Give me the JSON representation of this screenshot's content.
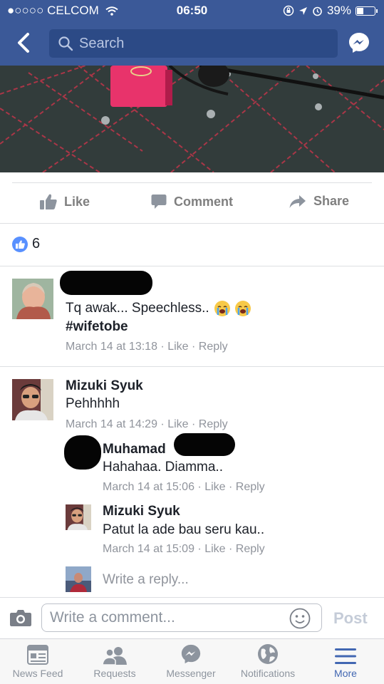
{
  "status_bar": {
    "signal": "●○○○○",
    "carrier": "CELCOM",
    "time": "06:50",
    "battery_label": "39%",
    "battery_level": 0.39
  },
  "nav": {
    "search_placeholder": "Search"
  },
  "actions": {
    "like": "Like",
    "comment": "Comment",
    "share": "Share"
  },
  "reactions": {
    "count": "6"
  },
  "comments": [
    {
      "text": "Tq awak... Speechless..",
      "hashtag": "#wifetobe",
      "timestamp": "March 14 at 13:18",
      "like": "Like",
      "reply": "Reply"
    },
    {
      "author": "Mizuki Syuk",
      "text": "Pehhhhh",
      "timestamp": "March 14 at 14:29",
      "like": "Like",
      "reply": "Reply",
      "replies": [
        {
          "author": "Muhamad",
          "text": "Hahahaa. Diamma..",
          "timestamp": "March 14 at 15:06",
          "like": "Like",
          "reply": "Reply"
        },
        {
          "author": "Mizuki Syuk",
          "text": "Patut la ade bau seru kau..",
          "timestamp": "March 14 at 15:09",
          "like": "Like",
          "reply": "Reply"
        }
      ]
    }
  ],
  "reply_composer": {
    "placeholder": "Write a reply..."
  },
  "comment_composer": {
    "placeholder": "Write a comment...",
    "post": "Post"
  },
  "tabs": [
    {
      "label": "News Feed",
      "icon": "news-feed-icon"
    },
    {
      "label": "Requests",
      "icon": "friend-requests-icon"
    },
    {
      "label": "Messenger",
      "icon": "messenger-icon"
    },
    {
      "label": "Notifications",
      "icon": "globe-icon"
    },
    {
      "label": "More",
      "icon": "menu-icon",
      "active": true
    }
  ],
  "colors": {
    "brand": "#3b5998",
    "search_bg": "#2c4a86",
    "active_tab": "#4267b2",
    "meta_text": "#90949c"
  }
}
